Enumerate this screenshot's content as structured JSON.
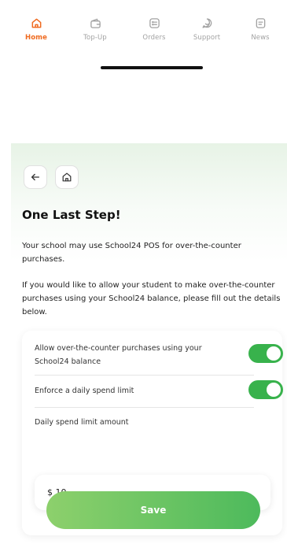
{
  "tabs": [
    {
      "label": "Home",
      "icon": "home-icon",
      "active": true
    },
    {
      "label": "Top-Up",
      "icon": "wallet-icon",
      "active": false
    },
    {
      "label": "Orders",
      "icon": "orders-icon",
      "active": false
    },
    {
      "label": "Support",
      "icon": "support-chat-icon",
      "active": false
    },
    {
      "label": "News",
      "icon": "news-icon",
      "active": false
    }
  ],
  "nav": {
    "back_icon": "arrow-left-icon",
    "home_icon": "home-icon"
  },
  "page": {
    "title": "One Last Step!",
    "paragraph_1": "Your school may use School24 POS for over-the-counter purchases.",
    "paragraph_2": "If you would like to allow your student to make over-the-counter purchases using your School24 balance, please fill out the details below."
  },
  "form": {
    "allow_otc_label": "Allow over-the-counter purchases using your School24 balance",
    "allow_otc_enabled": true,
    "daily_limit_label": "Enforce a daily spend limit",
    "daily_limit_enabled": true,
    "amount_label": "Daily spend limit amount",
    "amount_value": "$ 10",
    "save_label": "Save"
  },
  "colors": {
    "accent_active_tab": "#ef6a1f",
    "inactive_tab": "#a2a2a2",
    "toggle_on": "#38b24c",
    "save_gradient_start": "#8dd06c",
    "save_gradient_end": "#4dba5c"
  }
}
